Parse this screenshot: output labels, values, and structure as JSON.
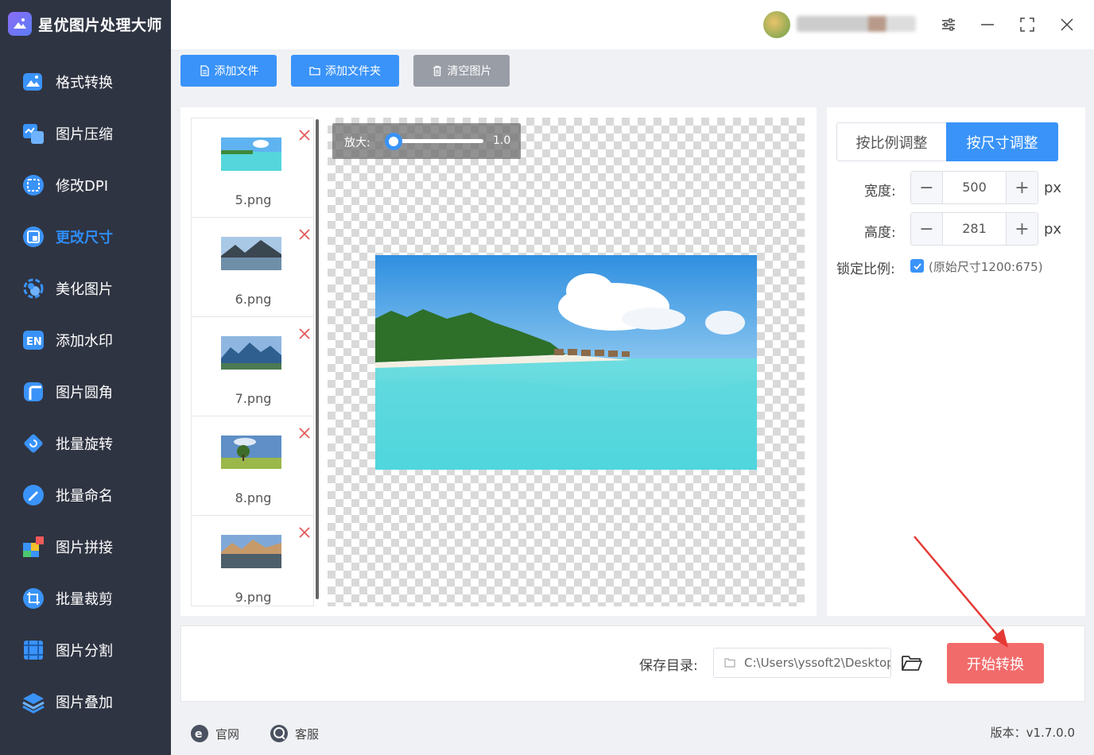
{
  "app": {
    "title": "星优图片处理大师"
  },
  "sidebar": {
    "items": [
      {
        "label": "格式转换",
        "icon": "image-convert-icon"
      },
      {
        "label": "图片压缩",
        "icon": "compress-icon"
      },
      {
        "label": "修改DPI",
        "icon": "dpi-icon"
      },
      {
        "label": "更改尺寸",
        "icon": "resize-icon",
        "active": true
      },
      {
        "label": "美化图片",
        "icon": "beautify-icon"
      },
      {
        "label": "添加水印",
        "icon": "watermark-icon"
      },
      {
        "label": "图片圆角",
        "icon": "round-corner-icon"
      },
      {
        "label": "批量旋转",
        "icon": "rotate-icon"
      },
      {
        "label": "批量命名",
        "icon": "rename-icon"
      },
      {
        "label": "图片拼接",
        "icon": "puzzle-icon"
      },
      {
        "label": "批量裁剪",
        "icon": "crop-icon"
      },
      {
        "label": "图片分割",
        "icon": "split-icon"
      },
      {
        "label": "图片叠加",
        "icon": "layers-icon"
      }
    ]
  },
  "toolbar": {
    "add_file": "添加文件",
    "add_folder": "添加文件夹",
    "clear": "清空图片"
  },
  "files": [
    {
      "name": "5.png"
    },
    {
      "name": "6.png"
    },
    {
      "name": "7.png"
    },
    {
      "name": "8.png"
    },
    {
      "name": "9.png"
    }
  ],
  "preview": {
    "zoom_label": "放大:",
    "zoom_value": "1.0"
  },
  "settings": {
    "mode_ratio": "按比例调整",
    "mode_size": "按尺寸调整",
    "width_label": "宽度:",
    "width_value": "500",
    "height_label": "高度:",
    "height_value": "281",
    "unit": "px",
    "lock_label": "锁定比例:",
    "lock_checked": true,
    "original_size": "(原始尺寸1200:675)"
  },
  "output": {
    "save_label": "保存目录:",
    "save_path": "C:\\Users\\yssoft2\\Desktop",
    "start_button": "开始转换"
  },
  "footer": {
    "website": "官网",
    "service": "客服",
    "version": "版本：v1.7.0.0"
  },
  "colors": {
    "sidebar_bg": "#2f3442",
    "accent": "#3a93f8",
    "start_button": "#f26b6b"
  }
}
